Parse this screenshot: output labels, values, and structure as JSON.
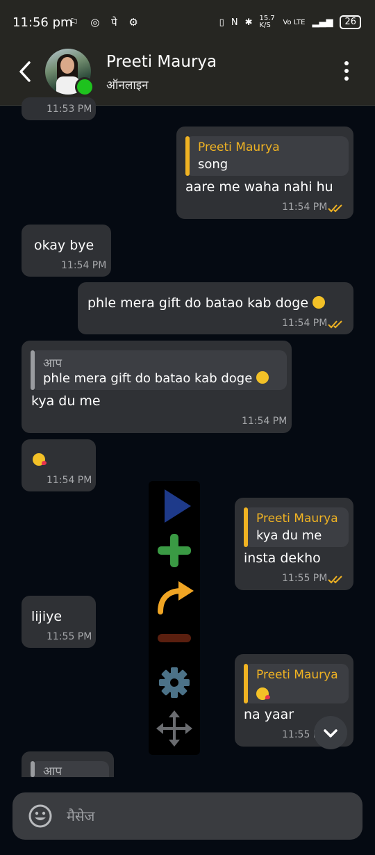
{
  "status_bar": {
    "time": "11:56 pm",
    "left_icons": "⚐ ◎ पे ⚙",
    "net_speed": "15.7 K/S",
    "battery": "26"
  },
  "header": {
    "name": "Preeti Maurya",
    "status": "ऑनलाइन"
  },
  "messages": [
    {
      "side": "in",
      "time": "11:53 PM"
    },
    {
      "side": "out",
      "quote_name": "Preeti Maurya",
      "quote_text": "song",
      "text": "aare me waha nahi hu",
      "time": "11:54 PM"
    },
    {
      "side": "in",
      "text": "okay bye",
      "time": "11:54 PM"
    },
    {
      "side": "out",
      "text": "phle mera gift do batao kab doge",
      "time": "11:54 PM"
    },
    {
      "side": "in",
      "quote_name": "आप",
      "quote_text": "phle mera gift do batao kab doge",
      "text": "kya du me",
      "time": "11:54 PM"
    },
    {
      "side": "in",
      "emoji": "kiss",
      "time": "11:54 PM"
    },
    {
      "side": "out",
      "quote_name": "Preeti Maurya",
      "quote_text": "kya du me",
      "text": "insta dekho",
      "time": "11:55 PM"
    },
    {
      "side": "in",
      "text": "lijiye",
      "time": "11:55 PM"
    },
    {
      "side": "out",
      "quote_name": "Preeti Maurya",
      "quote_emoji": "kiss",
      "text": "na yaar",
      "time": "11:55 PM"
    },
    {
      "side": "in",
      "quote_name": "आप"
    }
  ],
  "floating_panel": [
    "play-icon",
    "plus-icon",
    "forward-arrow-icon",
    "minus-icon",
    "gear-icon",
    "move-icon"
  ],
  "input": {
    "placeholder": "मैसेज"
  },
  "colors": {
    "bg": "#050a12",
    "bubble": "#2f3135",
    "quote": "#3c3e43",
    "quote_accent_gold": "#f0b323",
    "quote_accent_grey": "#9a9ca0",
    "read_ticks": "#f0b323",
    "online": "#1ec21e"
  }
}
